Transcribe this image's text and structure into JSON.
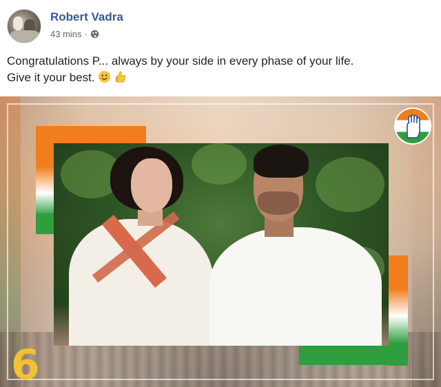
{
  "post": {
    "author": "Robert Vadra",
    "time": "43 mins",
    "separator": "·",
    "privacy_icon": "globe-icon",
    "text_line1": "Congratulations P... always by your side in every phase of your life.",
    "text_line2": "Give it your best.",
    "emojis": [
      "smiling-face-icon",
      "thumbs-up-icon"
    ]
  },
  "photo": {
    "logo_icon": "congress-hand-logo",
    "decorative_number": "6",
    "colors": {
      "saffron": "#f07e1c",
      "white": "#ffffff",
      "green": "#2e9e3f",
      "author_link": "#385898",
      "meta_text": "#606770"
    }
  }
}
